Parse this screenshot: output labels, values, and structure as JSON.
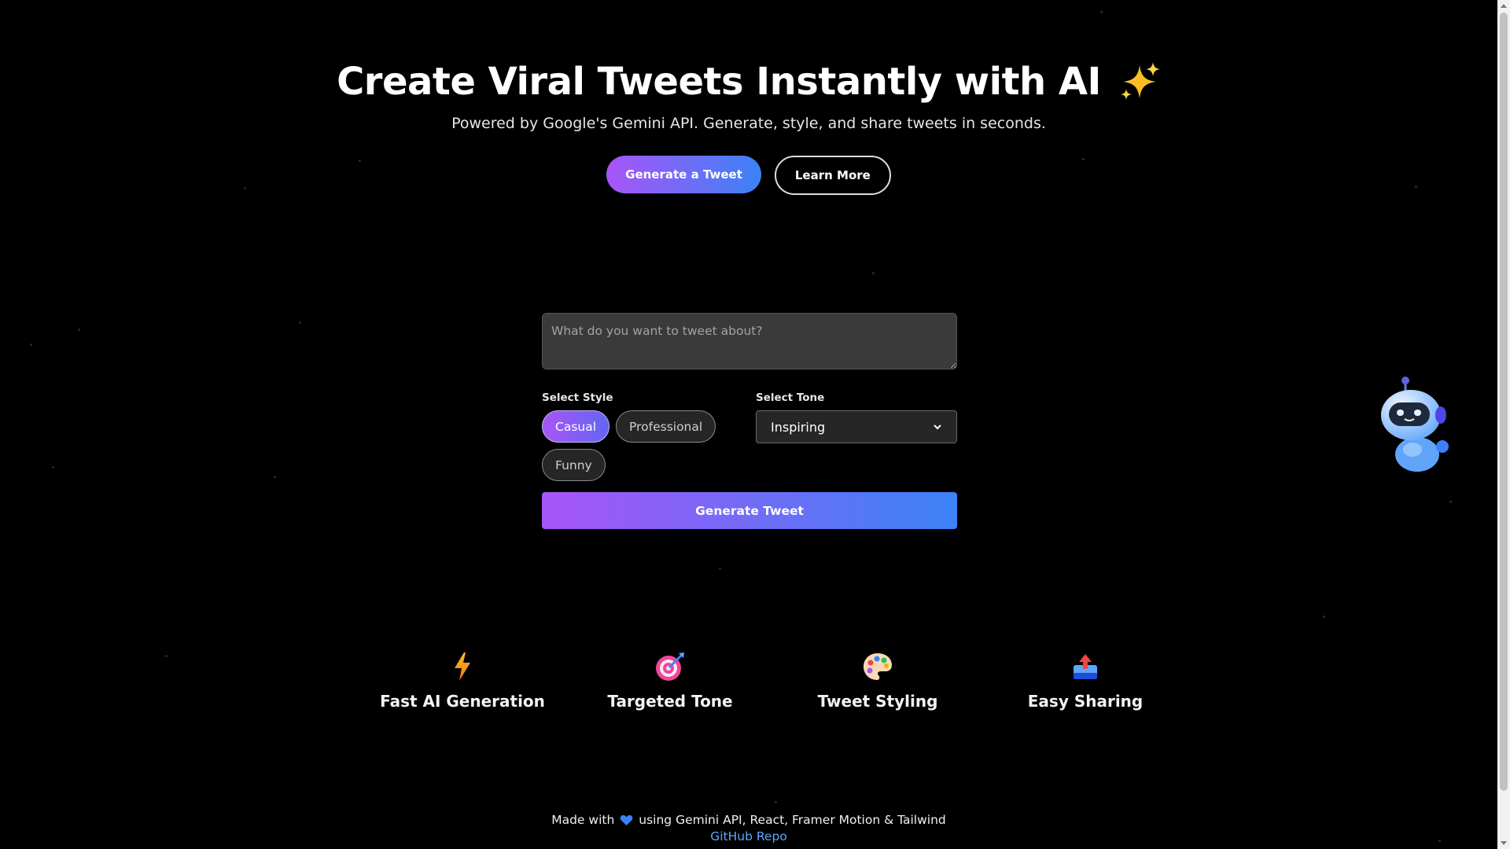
{
  "hero": {
    "title": "Create Viral Tweets Instantly with AI",
    "title_icon": "sparkles-icon",
    "subtitle": "Powered by Google's Gemini API. Generate, style, and share tweets in seconds.",
    "primary_button": "Generate a Tweet",
    "secondary_button": "Learn More"
  },
  "form": {
    "prompt_placeholder": "What do you want to tweet about?",
    "prompt_value": "",
    "style_label": "Select Style",
    "styles": [
      {
        "label": "Casual",
        "active": true
      },
      {
        "label": "Professional",
        "active": false
      },
      {
        "label": "Funny",
        "active": false
      }
    ],
    "tone_label": "Select Tone",
    "tone_value": "Inspiring",
    "generate_button": "Generate Tweet"
  },
  "features": [
    {
      "icon": "lightning-icon",
      "title": "Fast AI Generation"
    },
    {
      "icon": "target-icon",
      "title": "Targeted Tone"
    },
    {
      "icon": "palette-icon",
      "title": "Tweet Styling"
    },
    {
      "icon": "outbox-tray-icon",
      "title": "Easy Sharing"
    }
  ],
  "footer": {
    "made_with_prefix": "Made with",
    "heart_icon": "blue-heart-icon",
    "made_with_suffix": "using Gemini API, React, Framer Motion & Tailwind",
    "link_text": "GitHub Repo"
  },
  "colors": {
    "background": "#000000",
    "gradient_start": "#a855f7",
    "gradient_end": "#3b82f6",
    "link": "#60a5fa"
  }
}
